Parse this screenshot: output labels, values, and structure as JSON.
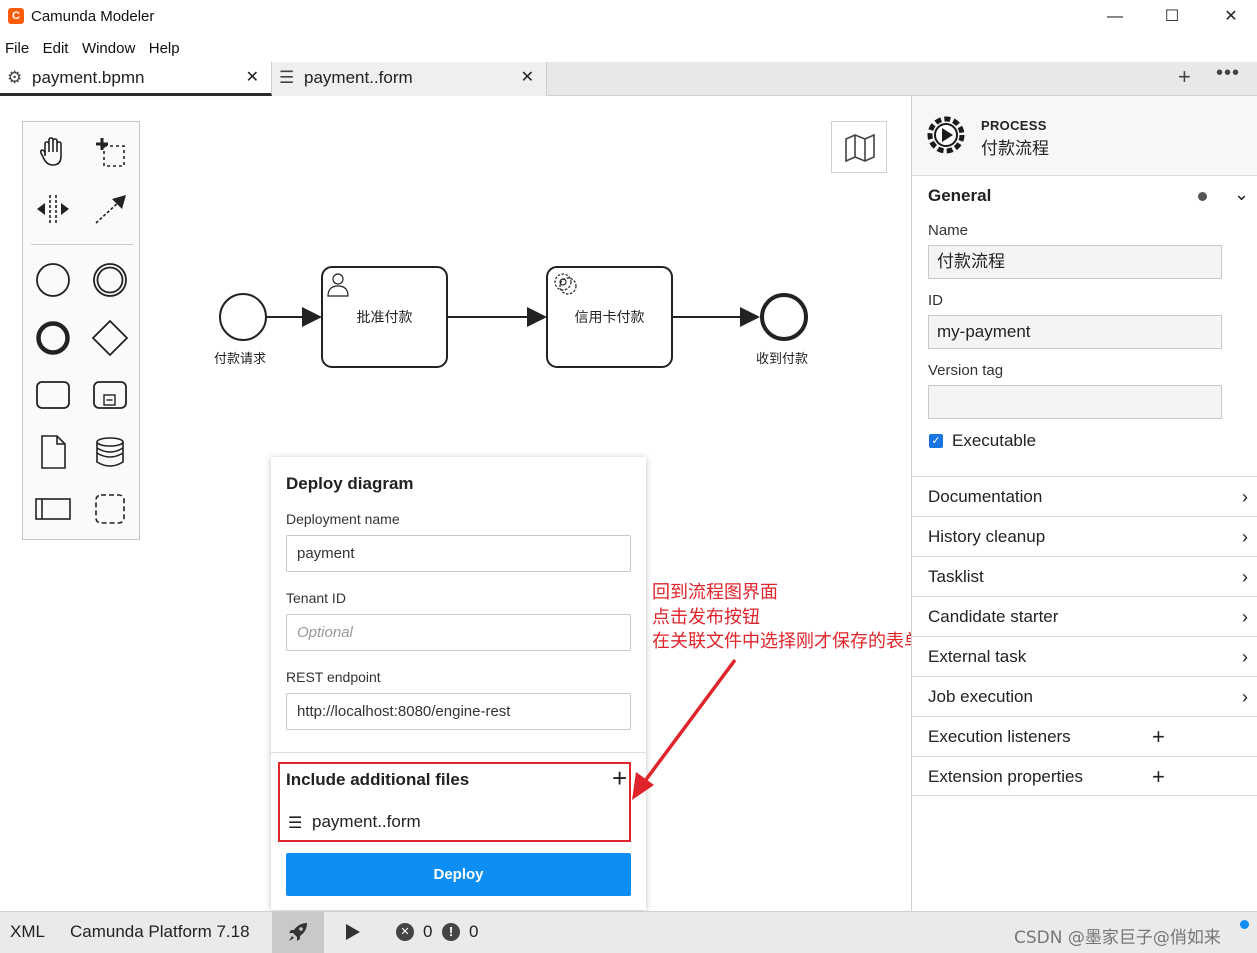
{
  "window": {
    "title": "Camunda Modeler",
    "logo": "C",
    "minimize": "—",
    "maximize": "☐",
    "close": "✕"
  },
  "menu": [
    "File",
    "Edit",
    "Window",
    "Help"
  ],
  "tabs": [
    {
      "label": "payment.bpmn",
      "icon": "gear-icon",
      "active": true
    },
    {
      "label": "payment..form",
      "icon": "form-icon",
      "active": false
    }
  ],
  "tab_actions": {
    "add": "+",
    "more": "•••"
  },
  "diagram": {
    "start_event": "付款请求",
    "user_task": "批准付款",
    "service_task": "信用卡付款",
    "end_event": "收到付款"
  },
  "deploy": {
    "title": "Deploy diagram",
    "deployment_name_label": "Deployment name",
    "deployment_name_value": "payment",
    "tenant_label": "Tenant ID",
    "tenant_placeholder": "Optional",
    "endpoint_label": "REST endpoint",
    "endpoint_value": "http://localhost:8080/engine-rest",
    "include_label": "Include additional files",
    "include_file": "payment..form",
    "deploy_button": "Deploy"
  },
  "annotation": {
    "line1": "回到流程图界面",
    "line2": "点击发布按钮",
    "line3": "在关联文件中选择刚才保存的表单",
    "color": "#e0242b"
  },
  "properties": {
    "type": "PROCESS",
    "name": "付款流程",
    "general_label": "General",
    "name_label": "Name",
    "name_value": "付款流程",
    "id_label": "ID",
    "id_value": "my-payment",
    "version_label": "Version tag",
    "version_value": "",
    "executable_label": "Executable",
    "executable_checked": true,
    "sections": [
      {
        "label": "Documentation",
        "action": "chevron"
      },
      {
        "label": "History cleanup",
        "action": "chevron"
      },
      {
        "label": "Tasklist",
        "action": "chevron"
      },
      {
        "label": "Candidate starter",
        "action": "chevron"
      },
      {
        "label": "External task",
        "action": "chevron"
      },
      {
        "label": "Job execution",
        "action": "chevron"
      },
      {
        "label": "Execution listeners",
        "action": "plus"
      },
      {
        "label": "Extension properties",
        "action": "plus"
      }
    ]
  },
  "statusbar": {
    "xml": "XML",
    "platform": "Camunda Platform 7.18",
    "errors": "0",
    "warnings": "0",
    "watermark": "CSDN @墨家巨子@俏如来"
  },
  "accent_color": "#0d8ef5"
}
